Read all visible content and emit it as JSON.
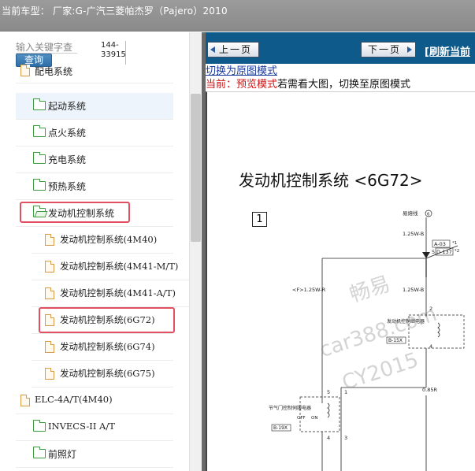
{
  "header": {
    "title": "当前车型： 厂家:G-广汽三菱帕杰罗（Pajero）2010"
  },
  "search": {
    "placeholder": "输入关键字查",
    "button_label": "查询",
    "count": "144-33915"
  },
  "tree": {
    "items": [
      {
        "label": "配电系统",
        "icon": "file-icon",
        "partial": true
      },
      {
        "label": "起动系统",
        "icon": "folder-icon",
        "highlighted": true
      },
      {
        "label": "点火系统",
        "icon": "folder-icon"
      },
      {
        "label": "充电系统",
        "icon": "folder-icon"
      },
      {
        "label": "预热系统",
        "icon": "folder-icon"
      },
      {
        "label": "发动机控制系统",
        "icon": "folder-open-icon",
        "boxed": true
      },
      {
        "label": "发动机控制系统(4M40)",
        "icon": "file-icon"
      },
      {
        "label": "发动机控制系统(4M41-M/T)",
        "icon": "file-icon"
      },
      {
        "label": "发动机控制系统(4M41-A/T)",
        "icon": "file-icon"
      },
      {
        "label": "发动机控制系统(6G72)",
        "icon": "file-icon",
        "boxed": true,
        "selected": true
      },
      {
        "label": "发动机控制系统(6G74)",
        "icon": "file-icon"
      },
      {
        "label": "发动机控制系统(6G75)",
        "icon": "file-icon"
      },
      {
        "label": "ELC-4A/T(4M40)",
        "icon": "file-icon"
      },
      {
        "label": "INVECS-II A/T",
        "icon": "folder-icon"
      },
      {
        "label": "前照灯",
        "icon": "folder-icon"
      }
    ]
  },
  "viewer": {
    "prev_label": "上一页",
    "next_label": "下一页",
    "refresh_label": "[刷新当前",
    "switch_link": "切换为原图模式",
    "status_prefix": "当前：预览模式",
    "status_suffix": "若需看大图，切换至原图模式"
  },
  "document": {
    "title": "发动机控制系统 <6G72>",
    "box_number": "1",
    "labels": {
      "fuse": "易熔线",
      "fuse_num": "6",
      "wire1": "1.25W-B",
      "conn1": "A-03",
      "conn2": "D-137",
      "star1": "*1",
      "star2": "*2",
      "pin5": "5",
      "wire2": "1.25W-B",
      "f_wire": "<F>1.25W-R",
      "relay_label": "发动机控制继电器",
      "relay_conn": "B-15X",
      "pin2": "2",
      "pin4": "4",
      "wire3": "0.85R",
      "throttle_label": "节气门控制伺服电器",
      "throttle_conn": "B-19X",
      "off": "OFF",
      "on": "ON",
      "pin5b": "5",
      "pin1": "1",
      "pin3": "3",
      "pin4b": "4"
    },
    "watermark": [
      "畅易",
      "car388.com",
      "CY2015"
    ]
  },
  "colors": {
    "header_bg": "#8e8e8e",
    "nav_bg": "#0e5a8a",
    "accent_red": "#e05060",
    "folder_green": "#3e9a3e",
    "file_orange": "#d99a4a"
  }
}
